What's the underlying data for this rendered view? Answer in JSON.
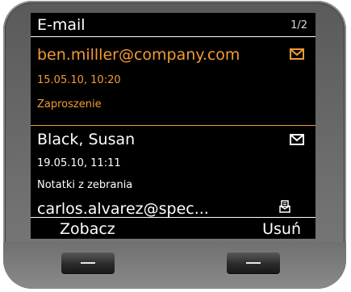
{
  "header": {
    "title": "E-mail",
    "page": "1/2"
  },
  "messages": [
    {
      "sender": "ben.milller@company.com",
      "datetime": "15.05.10, 10:20",
      "subject": "Zaproszenie",
      "icon": "envelope-icon",
      "selected": true
    },
    {
      "sender": "Black, Susan",
      "datetime": "19.05.10, 11:11",
      "subject": "Notatki z zebrania",
      "icon": "envelope-icon",
      "selected": false
    },
    {
      "sender": "carlos.alvarez@spec...",
      "icon": "envelope-read-icon",
      "selected": false
    }
  ],
  "softkeys": {
    "left": "Zobacz",
    "right": "Usuń"
  },
  "colors": {
    "accent": "#f39a35",
    "screen_bg": "#000000",
    "text": "#ffffff",
    "bezel": "#6b6b6b"
  }
}
